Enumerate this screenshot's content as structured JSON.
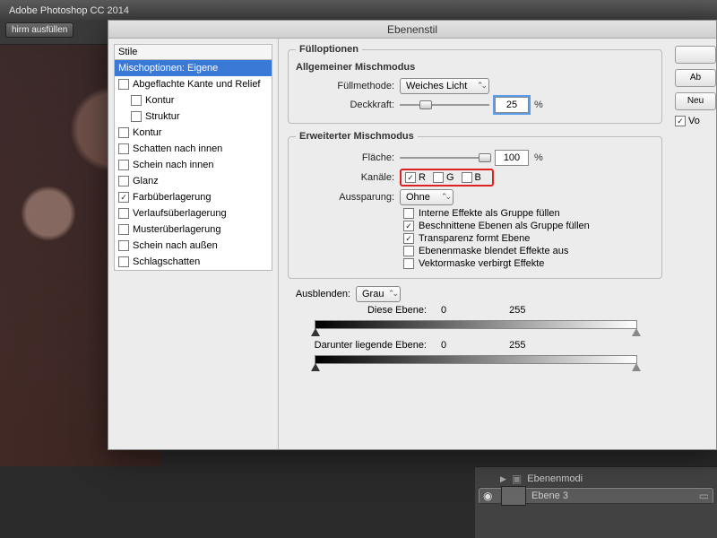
{
  "app": {
    "title": "Adobe Photoshop CC 2014"
  },
  "toolbar": {
    "fill_screen": "hirm ausfüllen"
  },
  "dialog": {
    "title": "Ebenenstil",
    "styles_header": "Stile",
    "styles": [
      {
        "id": "blend",
        "label": "Mischoptionen: Eigene",
        "checked": null,
        "selected": true,
        "indent": 0
      },
      {
        "id": "bevel",
        "label": "Abgeflachte Kante und Relief",
        "checked": false,
        "indent": 0
      },
      {
        "id": "contour",
        "label": "Kontur",
        "checked": false,
        "indent": 1
      },
      {
        "id": "texture",
        "label": "Struktur",
        "checked": false,
        "indent": 1
      },
      {
        "id": "stroke",
        "label": "Kontur",
        "checked": false,
        "indent": 0
      },
      {
        "id": "ishadow",
        "label": "Schatten nach innen",
        "checked": false,
        "indent": 0
      },
      {
        "id": "iglow",
        "label": "Schein nach innen",
        "checked": false,
        "indent": 0
      },
      {
        "id": "satin",
        "label": "Glanz",
        "checked": false,
        "indent": 0
      },
      {
        "id": "coloroverlay",
        "label": "Farbüberlagerung",
        "checked": true,
        "indent": 0
      },
      {
        "id": "gradoverlay",
        "label": "Verlaufsüberlagerung",
        "checked": false,
        "indent": 0
      },
      {
        "id": "patoverlay",
        "label": "Musterüberlagerung",
        "checked": false,
        "indent": 0
      },
      {
        "id": "oglow",
        "label": "Schein nach außen",
        "checked": false,
        "indent": 0
      },
      {
        "id": "dshadow",
        "label": "Schlagschatten",
        "checked": false,
        "indent": 0
      }
    ],
    "fill_options_legend": "Fülloptionen",
    "general_blend_heading": "Allgemeiner Mischmodus",
    "fill_method_label": "Füllmethode:",
    "fill_method_value": "Weiches Licht",
    "opacity_label": "Deckkraft:",
    "opacity_value": "25",
    "advanced_blend_legend": "Erweiterter Mischmodus",
    "fill_label": "Fläche:",
    "fill_value": "100",
    "channels_label": "Kanäle:",
    "channels": {
      "r": {
        "label": "R",
        "checked": true
      },
      "g": {
        "label": "G",
        "checked": false
      },
      "b": {
        "label": "B",
        "checked": false
      }
    },
    "knockout_label": "Aussparung:",
    "knockout_value": "Ohne",
    "flags": {
      "inner_group": {
        "label": "Interne Effekte als Gruppe füllen",
        "checked": false
      },
      "clipped_group": {
        "label": "Beschnittene Ebenen als Gruppe füllen",
        "checked": true
      },
      "trans_shapes": {
        "label": "Transparenz formt Ebene",
        "checked": true
      },
      "mask_hides": {
        "label": "Ebenenmaske blendet Effekte aus",
        "checked": false
      },
      "vmask_hides": {
        "label": "Vektormaske verbirgt Effekte",
        "checked": false
      }
    },
    "blendif_label": "Ausblenden:",
    "blendif_value": "Grau",
    "this_layer_label": "Diese Ebene:",
    "this_layer_lo": "0",
    "this_layer_hi": "255",
    "under_layer_label": "Darunter liegende Ebene:",
    "under_layer_lo": "0",
    "under_layer_hi": "255",
    "btn_ok": "",
    "btn_cancel": "Ab",
    "btn_new": "Neu",
    "preview_label": "Vo",
    "percent": "%"
  },
  "layers": {
    "group": "Ebenenmodi",
    "layer": "Ebene 3"
  }
}
